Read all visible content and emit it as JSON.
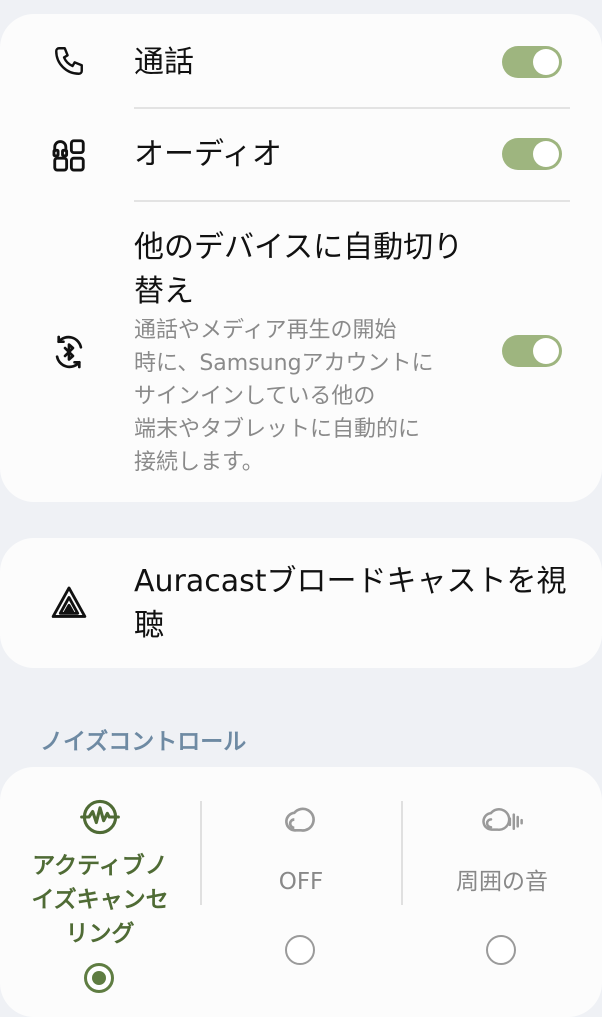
{
  "settings": {
    "call": {
      "label": "通話",
      "icon": "phone-icon",
      "enabled": true
    },
    "audio": {
      "label": "オーディオ",
      "icon": "apps-grid-icon",
      "enabled": true
    },
    "auto_switch": {
      "label_line1": "他のデバイスに自動切り",
      "label_line2": "替え",
      "desc_lines": [
        "通話やメディア再生の開始",
        "時に、Samsungアカウントに",
        "サインインしている他の",
        "端末やタブレットに自動的に",
        "接続します。"
      ],
      "icon": "bluetooth-sync-icon",
      "enabled": true
    }
  },
  "auracast": {
    "label_line1": "Auracastブロードキャストを視",
    "label_line2": "聴",
    "icon": "auracast-icon"
  },
  "noise_control": {
    "title": "ノイズコントロール",
    "options": [
      {
        "label_lines": [
          "アクティブノ",
          "イズキャンセ",
          "リング"
        ],
        "icon": "anc-waveform-icon",
        "selected": true
      },
      {
        "label_lines": [
          "OFF"
        ],
        "icon": "earbud-icon",
        "selected": false
      },
      {
        "label_lines": [
          "周囲の音"
        ],
        "icon": "ambient-sound-icon",
        "selected": false
      }
    ]
  },
  "colors": {
    "accent": "#9eb57f",
    "active_text": "#4f6b35",
    "section_title": "#6e8aa3",
    "background": "#eff1f5",
    "card": "#fcfcfc"
  }
}
